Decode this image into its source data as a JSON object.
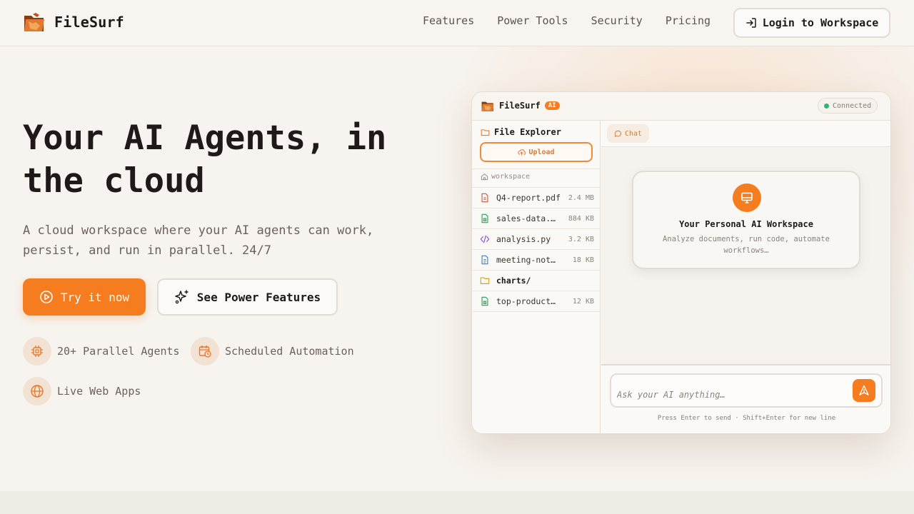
{
  "nav": {
    "brand": "FileSurf",
    "links": [
      "Features",
      "Power Tools",
      "Security",
      "Pricing"
    ],
    "login_label": "Login to Workspace"
  },
  "hero": {
    "title_line1": "Your AI Agents, in",
    "title_line2": "the cloud",
    "subtitle_line1": "A cloud workspace where your AI agents can work,",
    "subtitle_line2": "persist, and run in parallel. 24/7",
    "primary_cta": "Try it now",
    "secondary_cta": "See Power Features",
    "features": [
      {
        "label": "20+ Parallel Agents",
        "icon": "cpu-chip-icon"
      },
      {
        "label": "Scheduled Automation",
        "icon": "calendar-clock-icon"
      },
      {
        "label": "Live Web Apps",
        "icon": "globe-icon"
      }
    ]
  },
  "app": {
    "brand": "FileSurf",
    "badge": "AI",
    "status": "Connected",
    "sidebar": {
      "title": "File Explorer",
      "upload_label": "Upload",
      "crumb": "workspace",
      "files": [
        {
          "name": "Q4-report.pdf",
          "size": "2.4 MB",
          "icon": "pdf-file-icon"
        },
        {
          "name": "sales-data.csv",
          "size": "884 KB",
          "icon": "spreadsheet-file-icon"
        },
        {
          "name": "analysis.py",
          "size": "3.2 KB",
          "icon": "code-file-icon"
        },
        {
          "name": "meeting-notes.docx",
          "size": "18 KB",
          "icon": "document-file-icon"
        },
        {
          "name": "charts/",
          "size": "",
          "icon": "folder-icon"
        },
        {
          "name": "top-products.xlsx",
          "size": "12 KB",
          "icon": "spreadsheet-file-icon"
        }
      ]
    },
    "chat_tab": "Chat",
    "welcome": {
      "title": "Your Personal AI Workspace",
      "subtitle": "Analyze documents, run code, automate workflows…"
    },
    "composer": {
      "placeholder": "Ask your AI anything…",
      "hint": "Press Enter to send · Shift+Enter for new line"
    }
  },
  "colors": {
    "accent": "#f57c1f",
    "background": "#f7f3ee",
    "status_green": "#2bb673"
  }
}
